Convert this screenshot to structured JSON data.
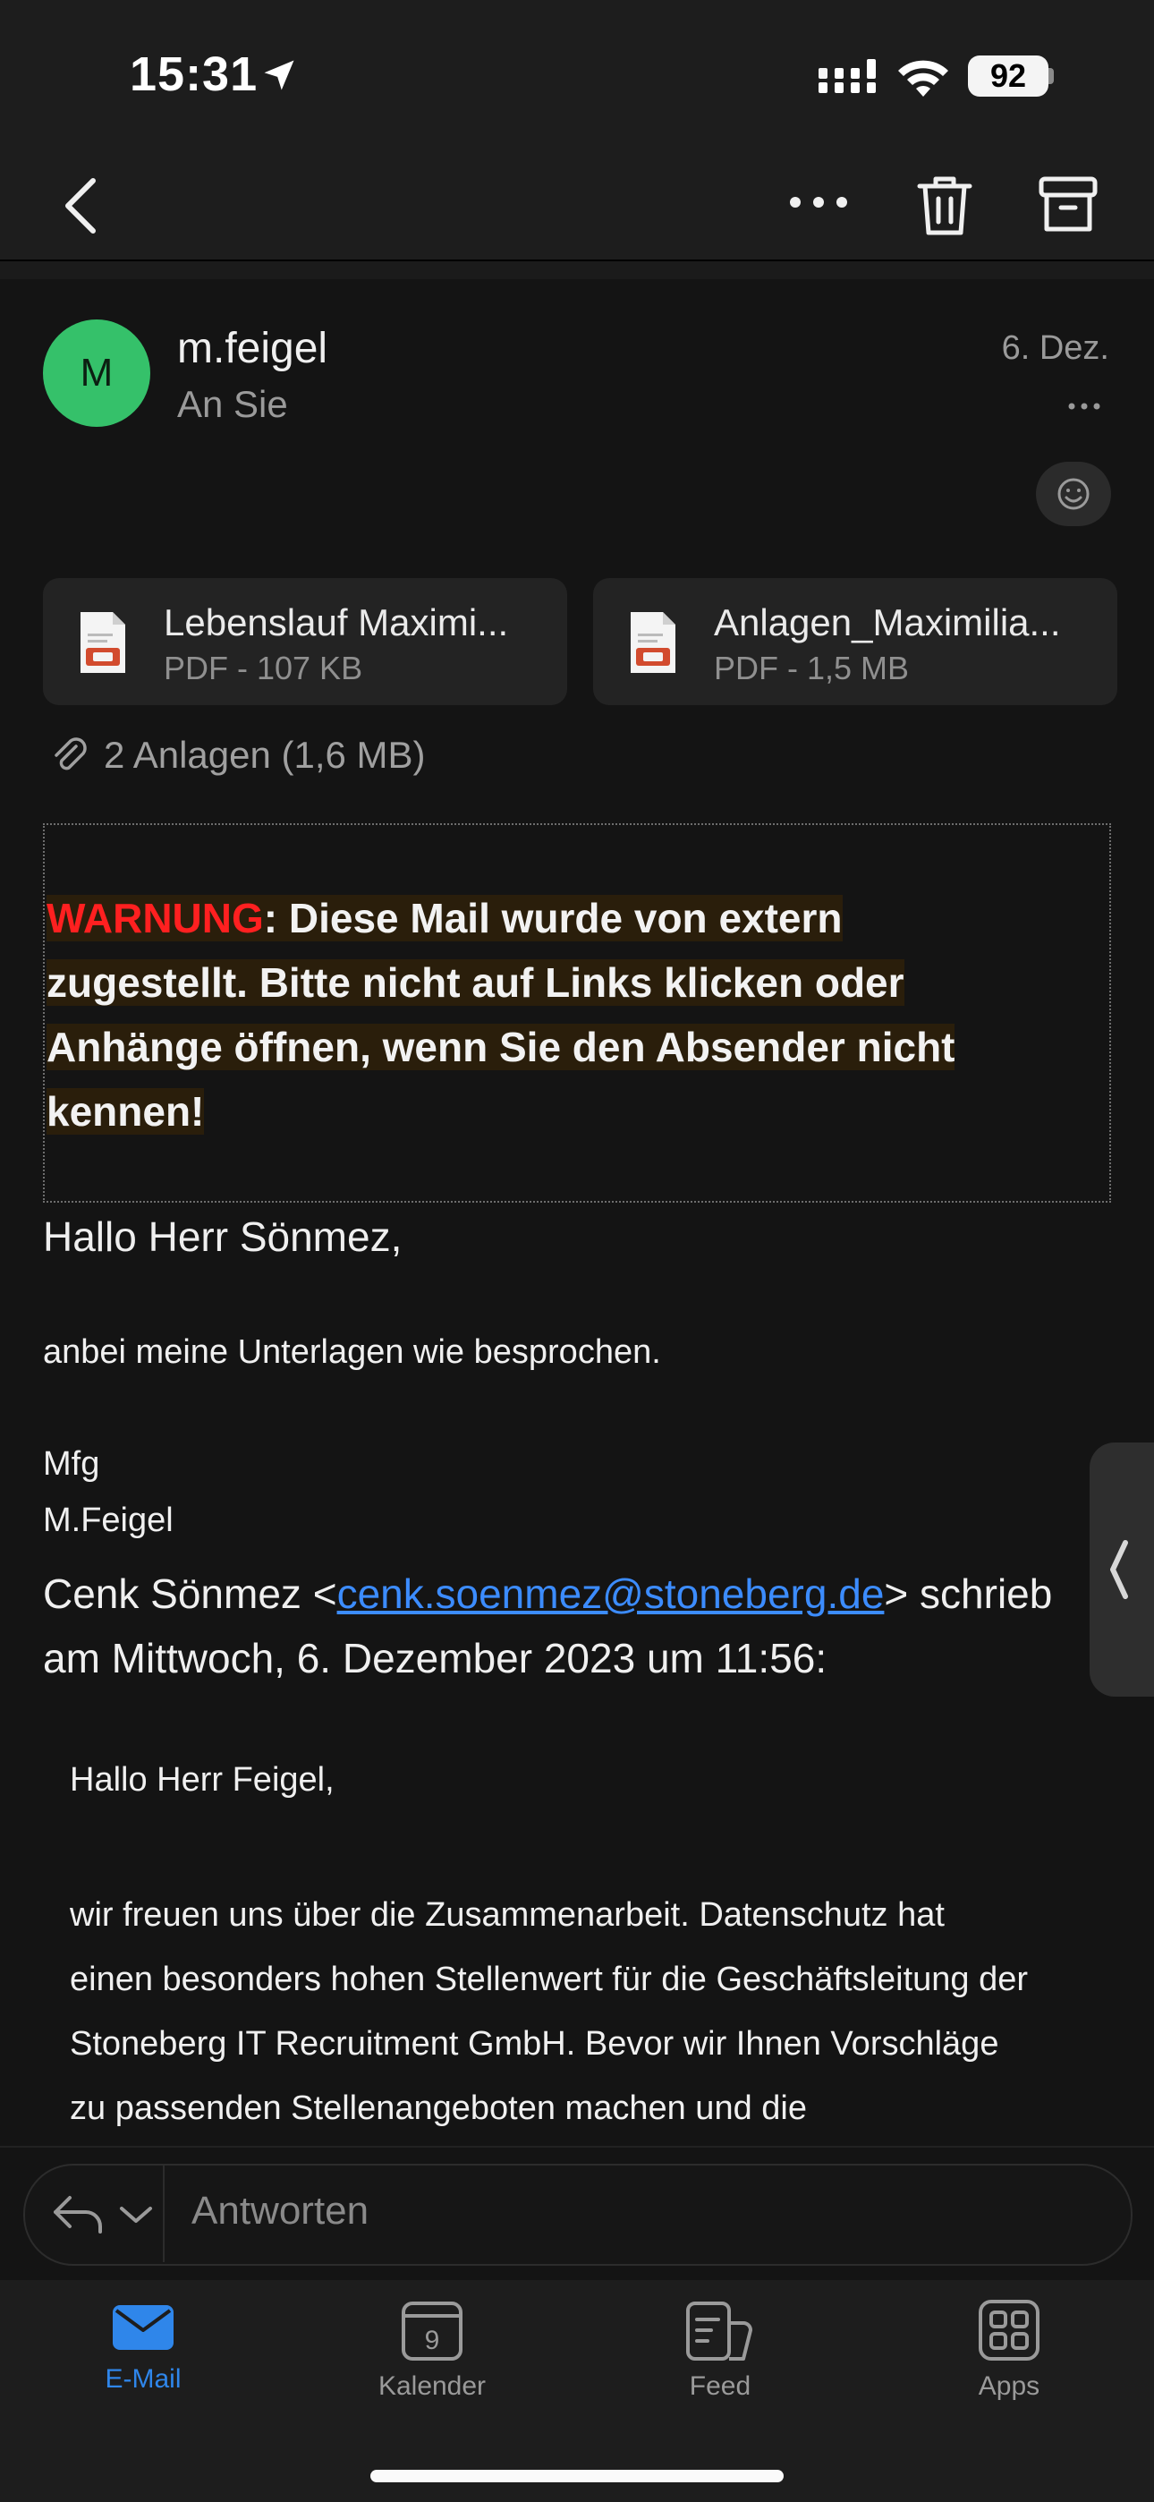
{
  "status_bar": {
    "time": "15:31",
    "battery": "92"
  },
  "message": {
    "avatar_initial": "M",
    "sender": "m.feigel",
    "recipient": "An Sie",
    "date": "6. Dez."
  },
  "attachments": [
    {
      "name": "Lebenslauf Maximi...",
      "meta": "PDF - 107 KB"
    },
    {
      "name": "Anlagen_Maximilia...",
      "meta": "PDF - 1,5 MB"
    }
  ],
  "attachments_summary": "2 Anlagen (1,6 MB)",
  "warning": {
    "label": "WARNUNG",
    "line1": ": Diese Mail wurde von extern",
    "line2": "zugestellt. Bitte nicht auf Links klicken oder",
    "line3": "Anhänge öffnen, wenn Sie den Absender nicht",
    "line4": "kennen!"
  },
  "body": {
    "greeting": "Hallo Herr Sönmez,",
    "line1": "anbei meine Unterlagen wie besprochen.",
    "closing": "Mfg",
    "signature": "M.Feigel",
    "quote_prefix": "Cenk Sönmez <",
    "quote_email": "cenk.soenmez@stoneberg.de",
    "quote_suffix": "> schrieb",
    "quote_date": "am Mittwoch, 6. Dezember 2023 um 11:56:"
  },
  "quoted": {
    "greeting": "Hallo Herr Feigel,",
    "line1": "wir freuen uns über die Zusammenarbeit. Datenschutz hat",
    "line2": "einen besonders hohen Stellenwert für die Geschäftsleitung der",
    "line3": "Stoneberg IT Recruitment GmbH. Bevor wir Ihnen Vorschläge",
    "line4": "zu passenden Stellenangeboten machen und die"
  },
  "reply": {
    "placeholder": "Antworten"
  },
  "tabs": [
    {
      "label": "E-Mail",
      "active": true
    },
    {
      "label": "Kalender",
      "day": "9"
    },
    {
      "label": "Feed"
    },
    {
      "label": "Apps"
    }
  ],
  "colors": {
    "accent": "#2f86ea",
    "avatar": "#35c16a",
    "warning": "#ff2020",
    "link": "#3c8cff"
  }
}
